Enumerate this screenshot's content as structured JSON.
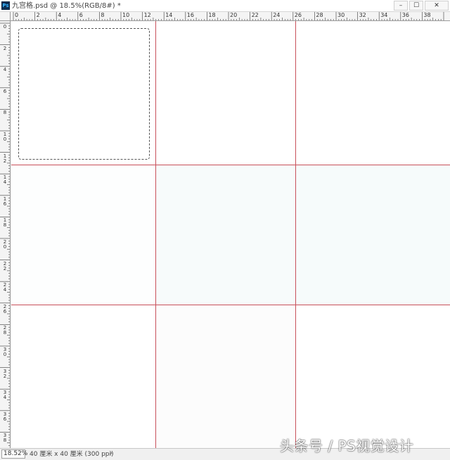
{
  "window": {
    "title": "九宫格.psd @ 18.5%(RGB/8#) *",
    "app_icon": "Ps",
    "minimize_icon": "minimize-icon",
    "maximize_icon": "maximize-icon",
    "close_icon": "close-icon",
    "min_glyph": "–",
    "max_glyph": "☐",
    "close_glyph": "✕"
  },
  "ruler_h": {
    "labels": [
      "0",
      "2",
      "4",
      "6",
      "8",
      "10",
      "12",
      "14",
      "16",
      "18",
      "20",
      "22",
      "24",
      "26",
      "28",
      "30",
      "32",
      "34",
      "36",
      "38"
    ]
  },
  "ruler_v": {
    "labels": [
      "0",
      "2",
      "4",
      "6",
      "8",
      "10",
      "12",
      "14",
      "16",
      "18",
      "20",
      "22",
      "24",
      "26",
      "28",
      "30",
      "32",
      "34",
      "36",
      "38"
    ]
  },
  "canvas": {
    "guide_color": "#c8505a",
    "document_size_cm": 40,
    "guides_cm": [
      13.3,
      26.6
    ]
  },
  "status": {
    "zoom": "18.52%",
    "doc_info": "40 厘米 x 40 厘米 (300 ppi)",
    "arrow": "›"
  },
  "watermark": "头条号 / PS视觉设计"
}
